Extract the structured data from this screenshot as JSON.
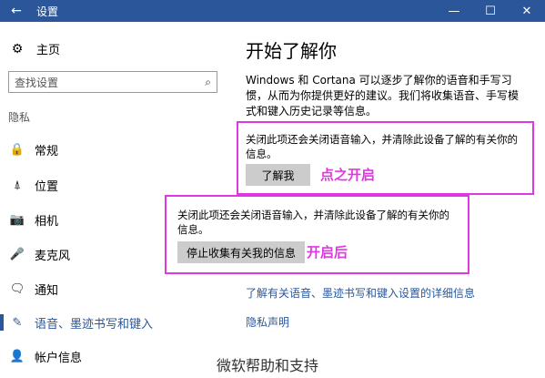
{
  "window": {
    "title": "设置",
    "back_icon": "←",
    "minimize": "—",
    "maximize": "☐",
    "close": "✕"
  },
  "sidebar": {
    "home": {
      "icon": "⚙",
      "label": "主页"
    },
    "search": {
      "placeholder": "查找设置",
      "icon": "⌕"
    },
    "section": "隐私",
    "items": [
      {
        "icon": "🔒",
        "label": "常规"
      },
      {
        "icon": "⍋",
        "label": "位置"
      },
      {
        "icon": "📷",
        "label": "相机"
      },
      {
        "icon": "🎤",
        "label": "麦克风"
      },
      {
        "icon": "🗨",
        "label": "通知"
      },
      {
        "icon": "✎",
        "label": "语音、墨迹书写和键入"
      },
      {
        "icon": "👤",
        "label": "帐户信息"
      }
    ]
  },
  "main": {
    "heading": "开始了解你",
    "description": "Windows 和 Cortana 可以逐步了解你的语音和手写习惯，从而为你提供更好的建议。我们将收集语音、手写模式和键入历史记录等信息。",
    "box1": {
      "text": "关闭此项还会关闭语音输入，并清除此设备了解的有关你的信息。",
      "button": "了解我",
      "annotation": "点之开启"
    },
    "box2": {
      "text": "关闭此项还会关闭语音输入，并清除此设备了解的有关你的信息。",
      "button": "停止收集有关我的信息",
      "annotation": "开启后"
    },
    "link1": "了解有关语音、墨迹书写和键入设置的详细信息",
    "link2": "隐私声明"
  },
  "watermark": "微软帮助和支持",
  "colors": {
    "accent": "#2b579a",
    "annotation": "#e038e0"
  }
}
